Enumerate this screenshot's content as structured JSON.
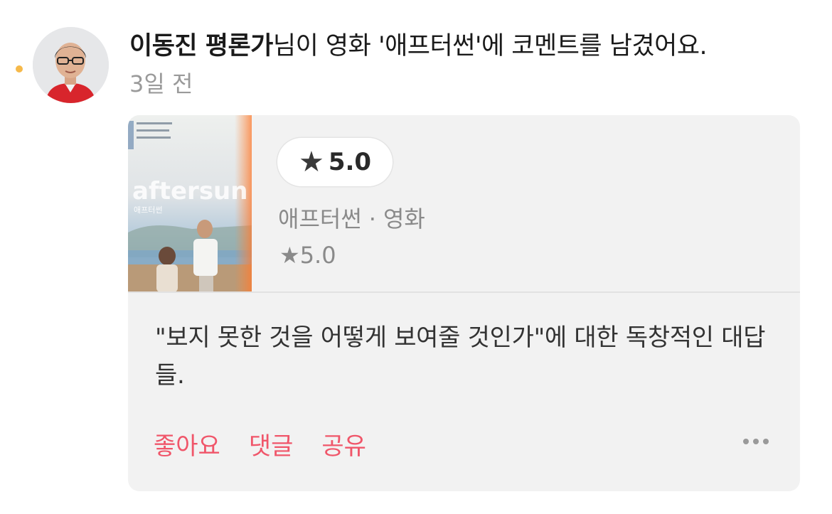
{
  "feed_item": {
    "actor_name": "이동진 평론가",
    "message": "님이 영화 '애프터썬'에 코멘트를 남겼어요.",
    "time_ago": "3일 전"
  },
  "card": {
    "poster": {
      "title": "aftersun",
      "title_ko": "애프터썬"
    },
    "rating_pill": {
      "star_icon": "★",
      "value": "5.0"
    },
    "movie_title": "애프터썬",
    "separator": "·",
    "category": "영화",
    "rating_line": "★5.0",
    "comment": "\"보지 못한 것을 어떻게 보여줄 것인가\"에 대한 독창적인 대답들.",
    "actions": {
      "like": "좋아요",
      "comment": "댓글",
      "share": "공유"
    }
  },
  "colors": {
    "accent": "#f0566a",
    "unread_dot": "#f6b94a",
    "card_bg": "#f2f2f2"
  },
  "icons": {
    "more": "more-icon",
    "star": "star-icon"
  }
}
